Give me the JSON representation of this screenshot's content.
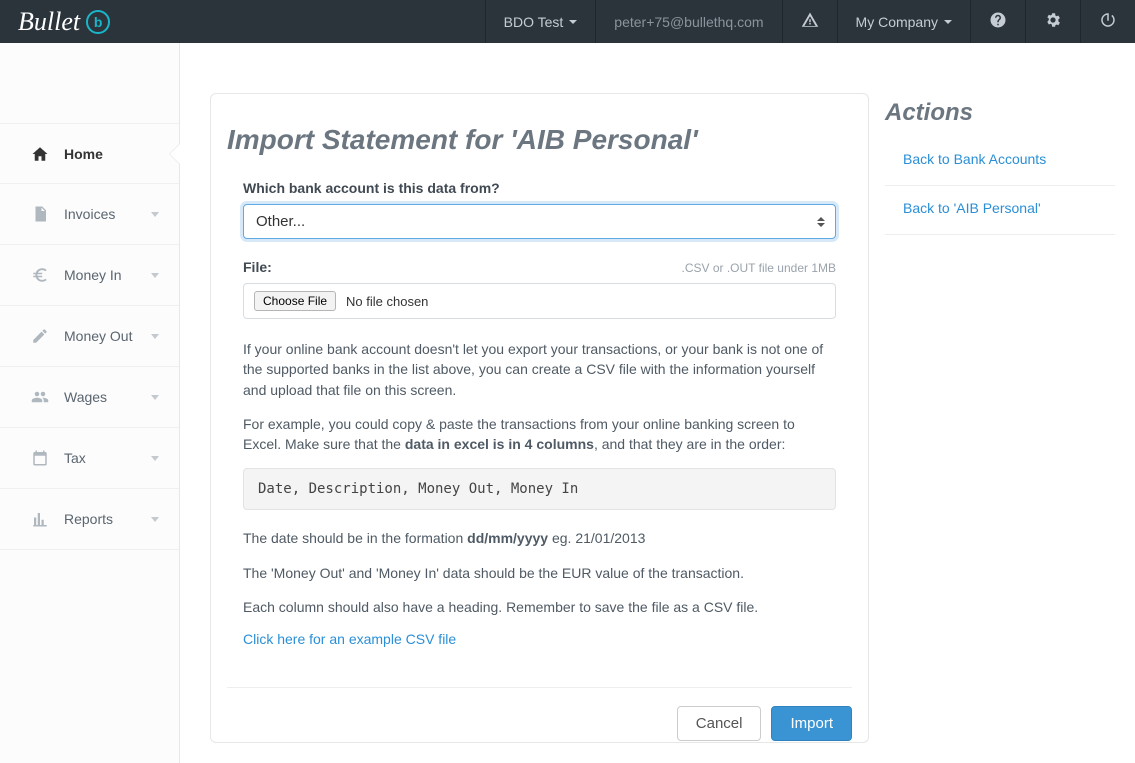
{
  "navbar": {
    "brand": "Bullet",
    "dropdown1": "BDO Test",
    "email": "peter+75@bullethq.com",
    "dropdown2": "My Company"
  },
  "sidebar": {
    "items": [
      {
        "label": "Home",
        "icon": "home",
        "active": true,
        "hasCaret": false
      },
      {
        "label": "Invoices",
        "icon": "file",
        "active": false,
        "hasCaret": true
      },
      {
        "label": "Money In",
        "icon": "euro",
        "active": false,
        "hasCaret": true
      },
      {
        "label": "Money Out",
        "icon": "edit",
        "active": false,
        "hasCaret": true
      },
      {
        "label": "Wages",
        "icon": "users",
        "active": false,
        "hasCaret": true
      },
      {
        "label": "Tax",
        "icon": "calendar",
        "active": false,
        "hasCaret": true
      },
      {
        "label": "Reports",
        "icon": "chart",
        "active": false,
        "hasCaret": true
      }
    ]
  },
  "page": {
    "title": "Import Statement for 'AIB Personal'",
    "bank_label": "Which bank account is this data from?",
    "bank_selected": "Other...",
    "file_label": "File:",
    "file_hint": ".CSV or .OUT file under 1MB",
    "file_button": "Choose File",
    "file_status": "No file chosen",
    "para1": "If your online bank account doesn't let you export your transactions, or your bank is not one of the supported banks in the list above, you can create a CSV file with the information yourself and upload that file on this screen.",
    "para2_a": "For example, you could copy & paste the transactions from your online banking screen to Excel. Make sure that the ",
    "para2_bold": "data in excel is in 4 columns",
    "para2_b": ", and that they are in the order:",
    "code_columns": "Date, Description, Money Out, Money In",
    "para3_a": "The date should be in the formation ",
    "para3_bold": "dd/mm/yyyy",
    "para3_b": " eg. 21/01/2013",
    "para4": "The 'Money Out' and 'Money In' data should be the EUR value of the transaction.",
    "para5": "Each column should also have a heading. Remember to save the file as a CSV file.",
    "example_link": "Click here for an example CSV file",
    "cancel": "Cancel",
    "import": "Import"
  },
  "actions": {
    "title": "Actions",
    "links": [
      "Back to Bank Accounts",
      "Back to 'AIB Personal'"
    ]
  }
}
